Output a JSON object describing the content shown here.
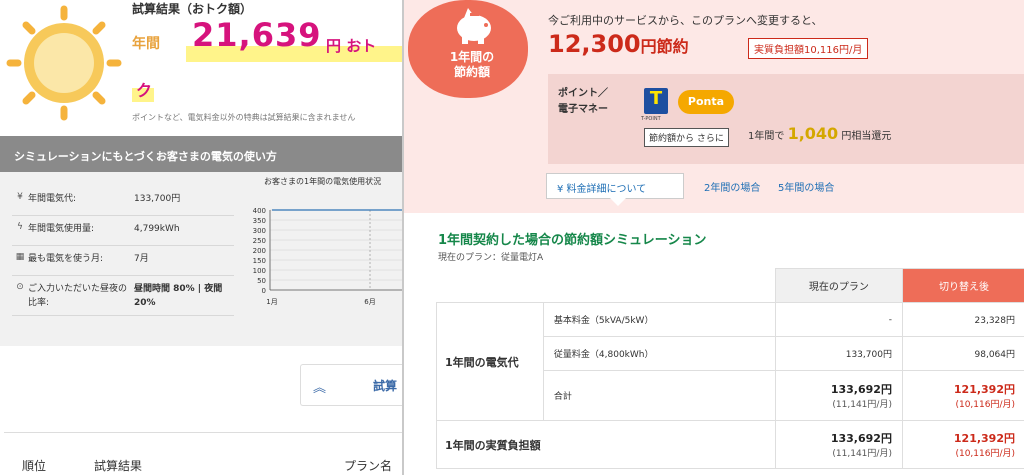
{
  "left": {
    "result_title": "試算結果（おトク額）",
    "nen_label": "年間",
    "amount": "21,639",
    "amount_unit": "円 おト",
    "amount_cont": "ク",
    "note": "ポイントなど、電気料金以外の特典は試算結果に含まれません",
    "sim_header": "シミュレーションにもとづくお客さまの電気の使い方",
    "usage": [
      {
        "icon": "¥",
        "label": "年間電気代:",
        "value": "133,700円"
      },
      {
        "icon": "ϟ",
        "label": "年間電気使用量:",
        "value": "4,799kWh"
      },
      {
        "icon": "▦",
        "label": "最も電気を使う月:",
        "value": "7月"
      },
      {
        "icon": "⊙",
        "label": "ご入力いただいた昼夜の比率:",
        "value": "昼間時間 80% | 夜間 20%"
      }
    ],
    "chart_title": "お客さまの1年間の電気使用状況",
    "collapse_label": "試算",
    "rank_headers": [
      "順位",
      "試算結果",
      "プラン名"
    ]
  },
  "chart_data": {
    "type": "line",
    "title": "お客さまの1年間の電気使用状況",
    "categories": [
      "1月",
      "6月"
    ],
    "yticks": [
      0,
      50,
      100,
      150,
      200,
      250,
      300,
      350,
      400
    ],
    "ylim": [
      0,
      400
    ],
    "series": [
      {
        "values": [
          400,
          400
        ]
      }
    ],
    "grid": true
  },
  "panel": {
    "badge_line1": "1年間の",
    "badge_line2": "節約額",
    "lead": "今ご利用中のサービスから、このプランへ変更すると、",
    "saving_amount": "12,300",
    "saving_unit": "円節約",
    "real_burden": "実質負担額10,116円/月",
    "point_label_1": "ポイント／",
    "point_label_2": "電子マネー",
    "tpoint_logo": "T",
    "tpoint_sub": "T-POINT",
    "ponta": "Ponta",
    "savings_tag": "節約額から さらに",
    "savings_prefix": "1年間で",
    "savings_num": "1,040",
    "savings_suffix": "円相当還元",
    "detail_tab": "¥  料金詳細について",
    "link_2y": "2年間の場合",
    "link_5y": "5年間の場合",
    "sim_title": "1年間契約した場合の節約額シミュレーション",
    "sim_sub": "現在のプラン：従量電灯A",
    "col_current": "現在のプラン",
    "col_new": "切り替え後",
    "cat_electric": "1年間の電気代",
    "rows": [
      {
        "label": "基本料金（5kVA/5kW）",
        "current": "-",
        "new": "23,328円"
      },
      {
        "label": "従量料金（4,800kWh）",
        "current": "133,700円",
        "new": "98,064円"
      }
    ],
    "total_label": "合計",
    "total_current": "133,692円",
    "total_current_mo": "(11,141円/月)",
    "total_new": "121,392円",
    "total_new_mo": "(10,116円/月)",
    "real_label": "1年間の実質負担額",
    "real_current": "133,692円",
    "real_current_mo": "(11,141円/月)",
    "real_new": "121,392円",
    "real_new_mo": "(10,116円/月)"
  },
  "colors": {
    "accent": "#ee6d58",
    "pink_bg": "#fde8e6",
    "magenta": "#d6137d",
    "green": "#16874a",
    "red": "#cc2a1a"
  }
}
